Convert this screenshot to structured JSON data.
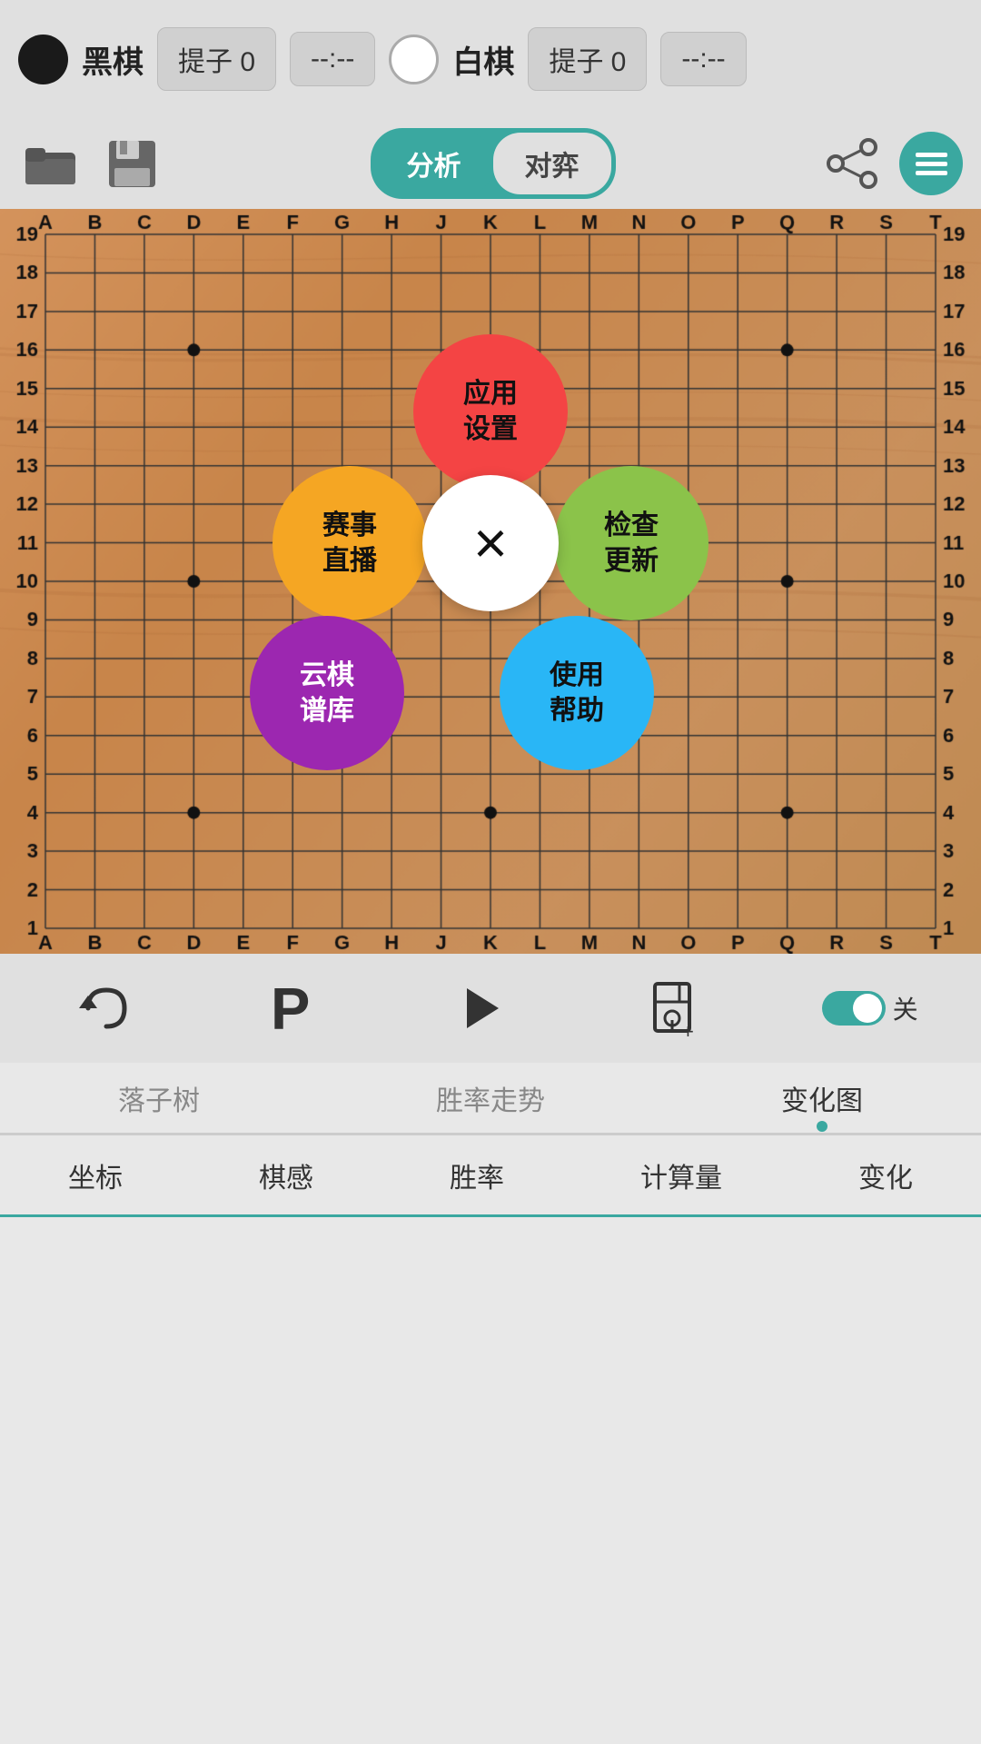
{
  "header": {
    "black_label": "黑棋",
    "black_capture_label": "提子",
    "black_capture_value": "0",
    "black_time": "--:--",
    "white_label": "白棋",
    "white_capture_label": "提子",
    "white_capture_value": "0",
    "white_time": "--:--"
  },
  "toolbar": {
    "mode_analysis": "分析",
    "mode_play": "对弈"
  },
  "board": {
    "cols": [
      "A",
      "B",
      "C",
      "D",
      "E",
      "F",
      "G",
      "H",
      "J",
      "K",
      "L",
      "M",
      "N",
      "O",
      "P",
      "Q",
      "R",
      "S",
      "T"
    ],
    "rows": [
      19,
      18,
      17,
      16,
      15,
      14,
      13,
      12,
      11,
      10,
      9,
      8,
      7,
      6,
      5,
      4,
      3,
      2,
      1
    ],
    "star_points": [
      [
        3,
        15
      ],
      [
        9,
        15
      ],
      [
        15,
        15
      ],
      [
        3,
        9
      ],
      [
        9,
        9
      ],
      [
        15,
        9
      ],
      [
        3,
        3
      ],
      [
        9,
        3
      ],
      [
        15,
        3
      ]
    ]
  },
  "popup": {
    "settings_label": "应用\n设置",
    "broadcast_label": "赛事\n直播",
    "update_label": "检查\n更新",
    "cloud_label": "云棋\n谱库",
    "help_label": "使用\n帮助",
    "close_symbol": "×"
  },
  "bottom": {
    "toggle_label": "关",
    "btn_undo": "↩",
    "btn_pass": "P",
    "btn_forward": ">",
    "btn_bookmark": "🔖"
  },
  "tabs": {
    "items": [
      "落子树",
      "胜率走势",
      "变化图"
    ],
    "active": 2
  },
  "detail_tabs": {
    "items": [
      "坐标",
      "棋感",
      "胜率",
      "计算量",
      "变化"
    ]
  },
  "colors": {
    "teal": "#3aa8a0",
    "board": "#c8955a",
    "red": "#f44444",
    "orange": "#f5a623",
    "green": "#8bc34a",
    "purple": "#9c27b0",
    "blue": "#29b6f6"
  }
}
